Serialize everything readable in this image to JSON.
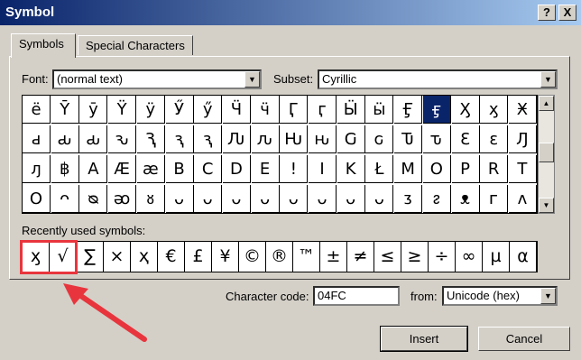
{
  "window": {
    "title": "Symbol",
    "help_label": "?",
    "close_label": "X"
  },
  "tabs": [
    {
      "label": "Symbols",
      "u": "S"
    },
    {
      "label": "Special Characters",
      "u": "P"
    }
  ],
  "font": {
    "label": "Font:",
    "value": "(normal text)"
  },
  "subset": {
    "label": "Subset:",
    "value": "Cyrillic"
  },
  "grid": [
    [
      "ё",
      "Ȳ",
      "ȳ",
      "Ÿ",
      "ÿ",
      "Ӳ",
      "ӳ",
      "Ӵ",
      "ӵ",
      "Ӷ",
      "ӷ",
      "Ӹ",
      "ӹ",
      "Ӻ",
      "ӻ",
      "Ӽ",
      "ӽ",
      "Ӿ"
    ],
    [
      "ԁ",
      "ԃ",
      "ԃ",
      "ԅ",
      "Ԇ",
      "ԇ",
      "ԇ",
      "Ԉ",
      "ԉ",
      "Ԋ",
      "ԋ",
      "Ԍ",
      "ԍ",
      "Ԏ",
      "ԏ",
      "Ԑ",
      "ԑ",
      "Ԓ"
    ],
    [
      "ԓ",
      "฿",
      "A",
      "Æ",
      "æ",
      "B",
      "C",
      "D",
      "E",
      "!",
      "I",
      "K",
      "Ł",
      "M",
      "O",
      "P",
      "R",
      "T"
    ],
    [
      "O",
      "ᴖ",
      "ᴓ",
      "ᴔ",
      "ᴕ",
      "ᴗ",
      "ᴗ",
      "ᴗ",
      "ᴗ",
      "ᴗ",
      "ᴗ",
      "ᴗ",
      "ᴗ",
      "ᴣ",
      "ᴤ",
      "ᴥ",
      "ᴦ",
      "ᴧ"
    ]
  ],
  "grid_selected": {
    "row": 0,
    "col": 14
  },
  "recent": {
    "label": "Recently used symbols:",
    "symbols": [
      "ӽ",
      "√",
      "∑",
      "×",
      "ҳ",
      "€",
      "£",
      "¥",
      "©",
      "®",
      "™",
      "±",
      "≠",
      "≤",
      "≥",
      "÷",
      "∞",
      "µ",
      "α"
    ]
  },
  "char_code": {
    "label": "Character code:",
    "value": "04FC"
  },
  "from": {
    "label": "from:",
    "value": "Unicode (hex)"
  },
  "buttons": {
    "insert": "Insert",
    "cancel": "Cancel"
  },
  "colors": {
    "highlight": "#e8353d",
    "title_start": "#0a246a",
    "title_end": "#a6caf0"
  }
}
